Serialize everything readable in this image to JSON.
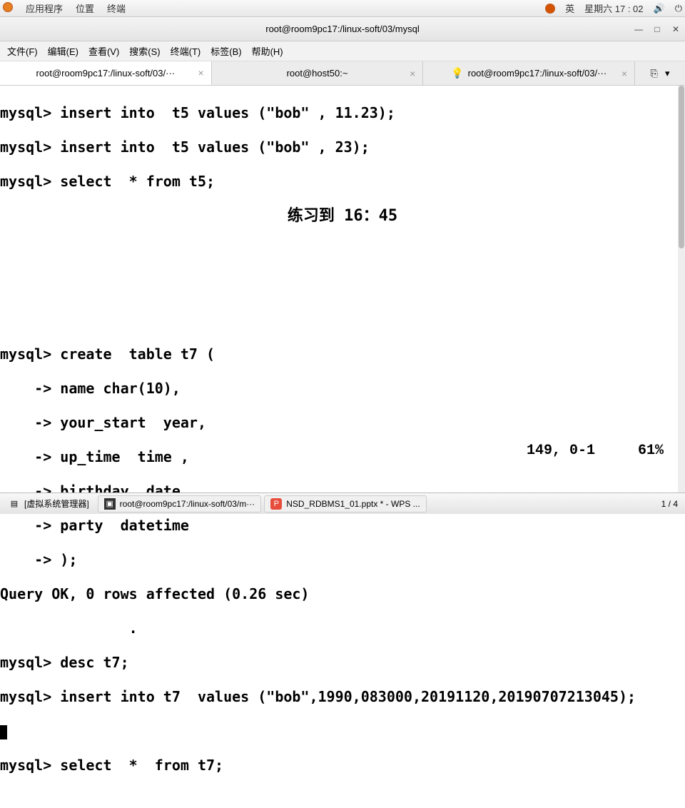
{
  "gnome": {
    "apps": "应用程序",
    "places": "位置",
    "terminal": "终端",
    "lang": "英",
    "date": "星期六 17 : 02"
  },
  "window": {
    "title": "root@room9pc17:/linux-soft/03/mysql"
  },
  "menu": {
    "file": "文件(F)",
    "edit": "编辑(E)",
    "view": "查看(V)",
    "search": "搜索(S)",
    "terminal": "终端(T)",
    "tabs": "标签(B)",
    "help": "帮助(H)"
  },
  "tabs": {
    "t1": "root@room9pc17:/linux-soft/03/···",
    "t2": "root@host50:~",
    "t3": "root@room9pc17:/linux-soft/03/···"
  },
  "term": {
    "l1": "mysql> insert into  t5 values (\"bob\" , 11.23);",
    "l2": "mysql> insert into  t5 values (\"bob\" , 23);",
    "l3": "mysql> select  * from t5;",
    "note": "练习到 16：45",
    "l4": "mysql> create  table t7 (",
    "l5": "    -> name char(10),",
    "l6": "    -> your_start  year,",
    "l7": "    -> up_time  time ,",
    "l8": "    -> birthday  date ,",
    "l9": "    -> party  datetime",
    "l10": "    -> );",
    "l11": "Query OK, 0 rows affected (0.26 sec)",
    "dot": "               .",
    "l12": "mysql> desc t7;",
    "l13": "mysql> insert into t7  values (\"bob\",1990,083000,20191120,20190707213045);",
    "l14": "mysql> select  *  from t7;",
    "pos": "149, 0-1",
    "pct": "61%"
  },
  "taskbar": {
    "vm": "[虚拟系统管理器]",
    "t1": "root@room9pc17:/linux-soft/03/m···",
    "t2": "NSD_RDBMS1_01.pptx * - WPS ...",
    "pager": "1 / 4"
  }
}
